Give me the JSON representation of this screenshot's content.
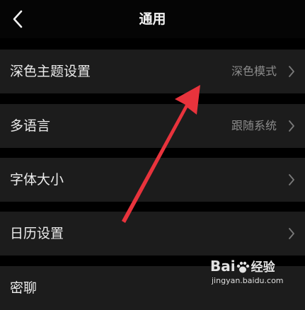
{
  "header": {
    "title": "通用",
    "back_icon": "chevron-left-icon"
  },
  "settings": {
    "items": [
      {
        "label": "深色主题设置",
        "value": "深色模式",
        "icon": "chevron-right-icon"
      },
      {
        "label": "多语言",
        "value": "跟随系统",
        "icon": "chevron-right-icon"
      },
      {
        "label": "字体大小",
        "value": "",
        "icon": "chevron-right-icon"
      },
      {
        "label": "日历设置",
        "value": "",
        "icon": "chevron-right-icon"
      },
      {
        "label": "密聊",
        "value": "",
        "icon": "chevron-right-icon"
      }
    ]
  },
  "annotation": {
    "color": "#e8333c",
    "icon": "pointer-arrow"
  },
  "watermark": {
    "brand_a": "Bai",
    "brand_b": "经验",
    "url": "jingyan.baidu.com"
  },
  "colors": {
    "background": "#000000",
    "row_background": "#1c1c1c",
    "label_text": "#ececec",
    "value_text": "#8c8c8c"
  }
}
